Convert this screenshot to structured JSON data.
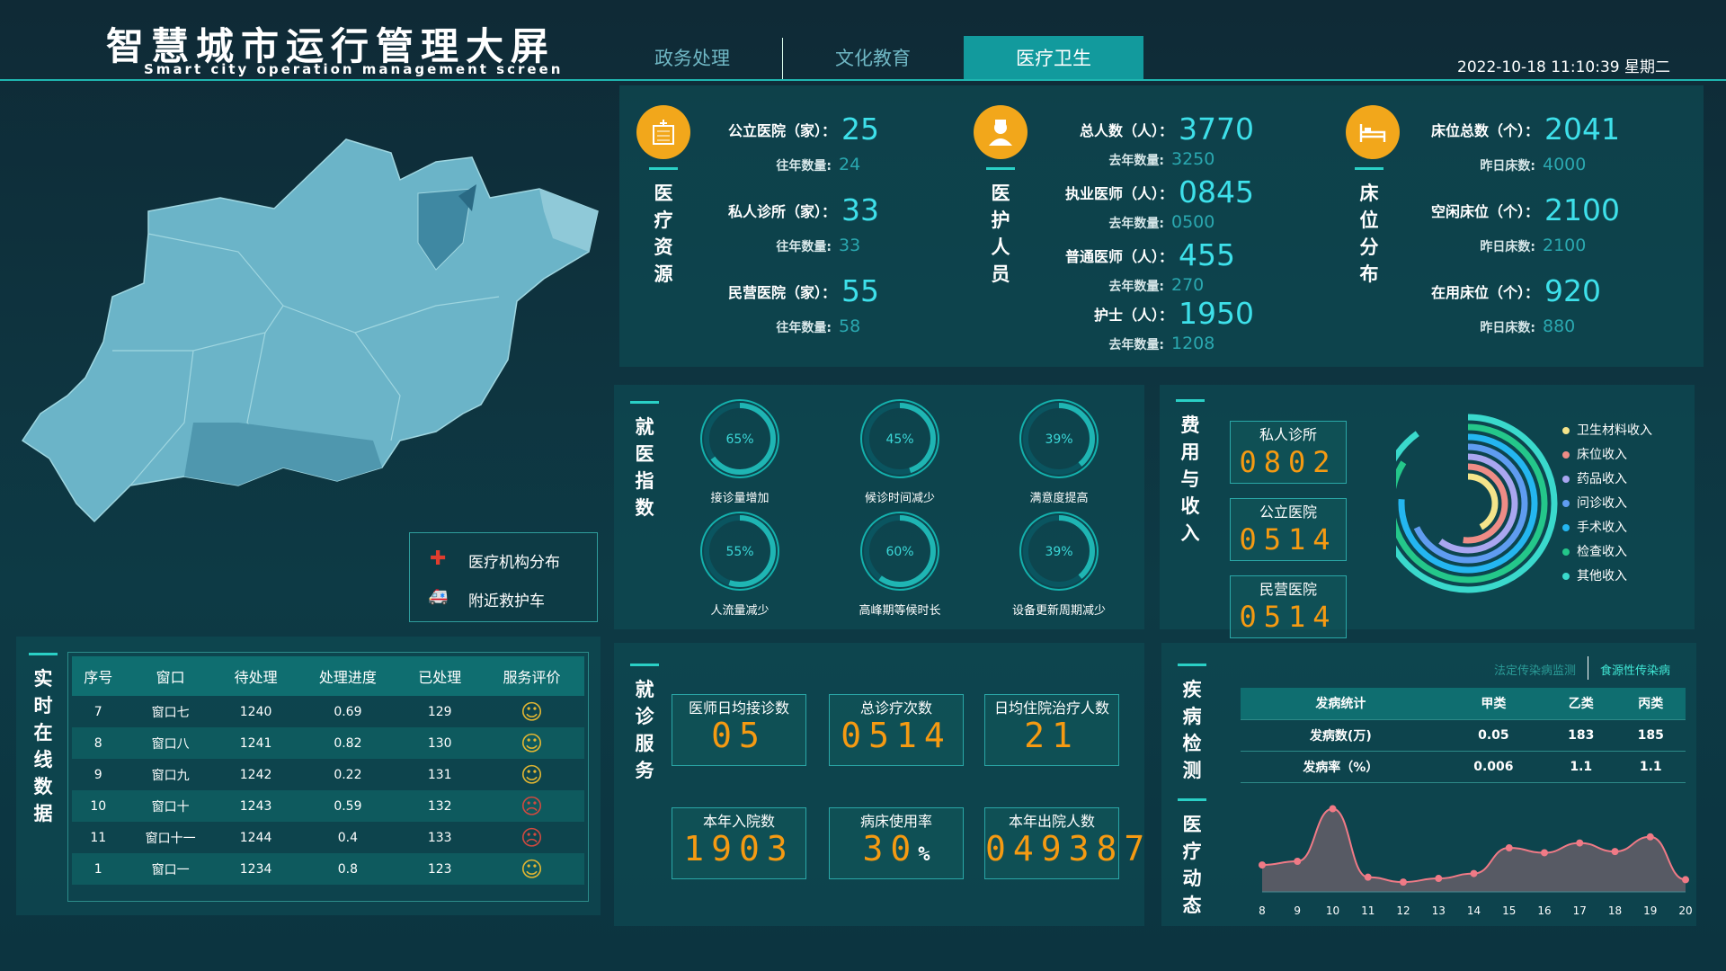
{
  "header": {
    "title": "智慧城市运行管理大屏",
    "subtitle": "Smart city operation management screen",
    "tabs": [
      "政务处理",
      "文化教育",
      "医疗卫生"
    ],
    "active_tab": "医疗卫生",
    "datetime": "2022-10-18 11:10:39 星期二"
  },
  "colors": {
    "accent": "#2ad0c6",
    "value": "#3ee0ea",
    "lcd": "#f59a12",
    "icon_bg": "#f2a71b",
    "map": "#6bb4c8"
  },
  "map_legend": [
    {
      "icon": "medical-cross-icon",
      "label": "医疗机构分布"
    },
    {
      "icon": "ambulance-icon",
      "label": "附近救护车"
    }
  ],
  "resources": {
    "title": "医疗资源",
    "icon": "hospital-icon",
    "items": [
      {
        "label": "公立医院（家）：",
        "value": "25",
        "sub_label": "往年数量:",
        "sub_value": "24"
      },
      {
        "label": "私人诊所（家）：",
        "value": "33",
        "sub_label": "往年数量:",
        "sub_value": "33"
      },
      {
        "label": "民营医院（家）：",
        "value": "55",
        "sub_label": "往年数量:",
        "sub_value": "58"
      }
    ]
  },
  "staff": {
    "title": "医护人员",
    "icon": "nurse-icon",
    "items": [
      {
        "label": "总人数（人）：",
        "value": "3770",
        "sub_label": "去年数量:",
        "sub_value": "3250"
      },
      {
        "label": "执业医师（人）：",
        "value": "0845",
        "sub_label": "去年数量:",
        "sub_value": "0500"
      },
      {
        "label": "普通医师（人）：",
        "value": "455",
        "sub_label": "去年数量:",
        "sub_value": "270"
      },
      {
        "label": "护士（人）：",
        "value": "1950",
        "sub_label": "去年数量:",
        "sub_value": "1208"
      }
    ]
  },
  "beds": {
    "title": "床位分布",
    "icon": "bed-icon",
    "items": [
      {
        "label": "床位总数（个）：",
        "value": "2041",
        "sub_label": "昨日床数:",
        "sub_value": "4000"
      },
      {
        "label": "空闲床位（个）：",
        "value": "2100",
        "sub_label": "昨日床数:",
        "sub_value": "2100"
      },
      {
        "label": "在用床位（个）：",
        "value": "920",
        "sub_label": "昨日床数:",
        "sub_value": "880"
      }
    ]
  },
  "medical_index": {
    "title": "就医指数",
    "gauges": [
      {
        "percent": 65,
        "text": "65%",
        "label": "接诊量增加"
      },
      {
        "percent": 45,
        "text": "45%",
        "label": "候诊时间减少"
      },
      {
        "percent": 39,
        "text": "39%",
        "label": "满意度提高"
      },
      {
        "percent": 55,
        "text": "55%",
        "label": "人流量减少"
      },
      {
        "percent": 60,
        "text": "60%",
        "label": "高峰期等候时长"
      },
      {
        "percent": 39,
        "text": "39%",
        "label": "设备更新周期减少"
      }
    ]
  },
  "fees": {
    "title": "费用与收入",
    "boxes": [
      {
        "label": "私人诊所",
        "value": "0802"
      },
      {
        "label": "公立医院",
        "value": "0514"
      },
      {
        "label": "民营医院",
        "value": "0514"
      }
    ],
    "legend": [
      {
        "name": "卫生材料收入",
        "color": "#f4e48a"
      },
      {
        "name": "床位收入",
        "color": "#ee8c86"
      },
      {
        "name": "药品收入",
        "color": "#a9a6f0"
      },
      {
        "name": "问诊收入",
        "color": "#5f9cf0"
      },
      {
        "name": "手术收入",
        "color": "#24b6f0"
      },
      {
        "name": "检查收入",
        "color": "#24c78a"
      },
      {
        "name": "其他收入",
        "color": "#3ad9cc"
      }
    ],
    "rings": [
      0.42,
      0.52,
      0.6,
      0.68,
      0.76,
      0.84,
      0.9
    ]
  },
  "realtime": {
    "title": "实时在线数据",
    "columns": [
      "序号",
      "窗口",
      "待处理",
      "处理进度",
      "已处理",
      "服务评价"
    ],
    "rows": [
      [
        "7",
        "窗口七",
        "1240",
        "0.69",
        "129",
        "good"
      ],
      [
        "8",
        "窗口八",
        "1241",
        "0.82",
        "130",
        "good"
      ],
      [
        "9",
        "窗口九",
        "1242",
        "0.22",
        "131",
        "good"
      ],
      [
        "10",
        "窗口十",
        "1243",
        "0.59",
        "132",
        "bad"
      ],
      [
        "11",
        "窗口十一",
        "1244",
        "0.4",
        "133",
        "bad"
      ],
      [
        "1",
        "窗口一",
        "1234",
        "0.8",
        "123",
        "good"
      ]
    ]
  },
  "service": {
    "title": "就诊服务",
    "boxes": [
      {
        "label": "医师日均接诊数",
        "value": "05",
        "suffix": ""
      },
      {
        "label": "总诊疗次数",
        "value": "0514",
        "suffix": ""
      },
      {
        "label": "日均住院治疗人数",
        "value": "21",
        "suffix": ""
      },
      {
        "label": "本年入院数",
        "value": "1903",
        "suffix": ""
      },
      {
        "label": "病床使用率",
        "value": "30",
        "suffix": "%"
      },
      {
        "label": "本年出院人数",
        "value": "049387",
        "suffix": ""
      }
    ]
  },
  "disease": {
    "title": "疾病检测",
    "tabs": [
      "法定传染病监测",
      "食源性传染病"
    ],
    "active_tab": "食源性传染病",
    "columns": [
      "发病统计",
      "甲类",
      "乙类",
      "丙类"
    ],
    "rows": [
      [
        "发病数(万)",
        "0.05",
        "183",
        "185"
      ],
      [
        "发病率（%）",
        "0.006",
        "1.1",
        "1.1"
      ]
    ]
  },
  "trend": {
    "title": "医疗动态"
  },
  "chart_data": {
    "type": "area",
    "x": [
      "8",
      "9",
      "10",
      "11",
      "12",
      "13",
      "14",
      "15",
      "16",
      "17",
      "18",
      "19",
      "20"
    ],
    "series": [
      {
        "values": [
          22,
          25,
          68,
          12,
          8,
          11,
          15,
          36,
          32,
          40,
          33,
          45,
          10
        ]
      }
    ],
    "ylim": [
      0,
      75
    ]
  }
}
